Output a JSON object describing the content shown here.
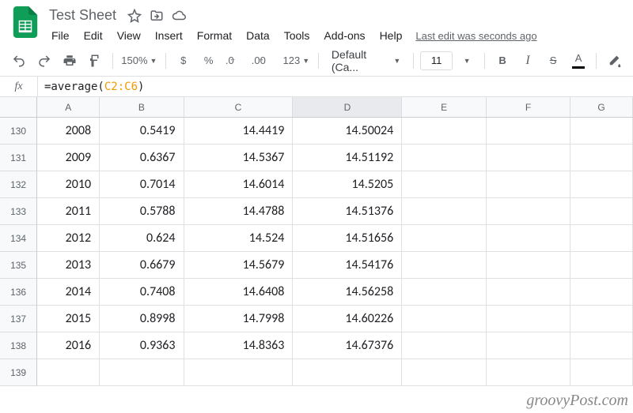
{
  "doc": {
    "title": "Test Sheet",
    "last_edit": "Last edit was seconds ago"
  },
  "menu": {
    "file": "File",
    "edit": "Edit",
    "view": "View",
    "insert": "Insert",
    "format": "Format",
    "data": "Data",
    "tools": "Tools",
    "addons": "Add-ons",
    "help": "Help"
  },
  "toolbar": {
    "zoom": "150%",
    "currency": "$",
    "percent": "%",
    "dec_dec": ".0",
    "dec_inc": ".00",
    "more_formats": "123",
    "font": "Default (Ca...",
    "font_size": "11",
    "bold": "B",
    "italic": "I",
    "strike": "S",
    "text_color": "A"
  },
  "formula": {
    "prefix": "=average(",
    "range": "C2:C6",
    "suffix": ")"
  },
  "columns": [
    "A",
    "B",
    "C",
    "D",
    "E",
    "F",
    "G"
  ],
  "col_widths": [
    "w-a",
    "w-b",
    "w-c",
    "w-d",
    "w-e",
    "w-f",
    "w-g"
  ],
  "selected_col_index": 3,
  "rows": [
    {
      "n": 130,
      "cells": [
        "2008",
        "0.5419",
        "14.4419",
        "14.50024",
        "",
        "",
        ""
      ]
    },
    {
      "n": 131,
      "cells": [
        "2009",
        "0.6367",
        "14.5367",
        "14.51192",
        "",
        "",
        ""
      ]
    },
    {
      "n": 132,
      "cells": [
        "2010",
        "0.7014",
        "14.6014",
        "14.5205",
        "",
        "",
        ""
      ]
    },
    {
      "n": 133,
      "cells": [
        "2011",
        "0.5788",
        "14.4788",
        "14.51376",
        "",
        "",
        ""
      ]
    },
    {
      "n": 134,
      "cells": [
        "2012",
        "0.624",
        "14.524",
        "14.51656",
        "",
        "",
        ""
      ]
    },
    {
      "n": 135,
      "cells": [
        "2013",
        "0.6679",
        "14.5679",
        "14.54176",
        "",
        "",
        ""
      ]
    },
    {
      "n": 136,
      "cells": [
        "2014",
        "0.7408",
        "14.6408",
        "14.56258",
        "",
        "",
        ""
      ]
    },
    {
      "n": 137,
      "cells": [
        "2015",
        "0.8998",
        "14.7998",
        "14.60226",
        "",
        "",
        ""
      ]
    },
    {
      "n": 138,
      "cells": [
        "2016",
        "0.9363",
        "14.8363",
        "14.67376",
        "",
        "",
        ""
      ]
    },
    {
      "n": 139,
      "cells": [
        "",
        "",
        "",
        "",
        "",
        "",
        ""
      ]
    }
  ],
  "watermark": "groovyPost.com"
}
